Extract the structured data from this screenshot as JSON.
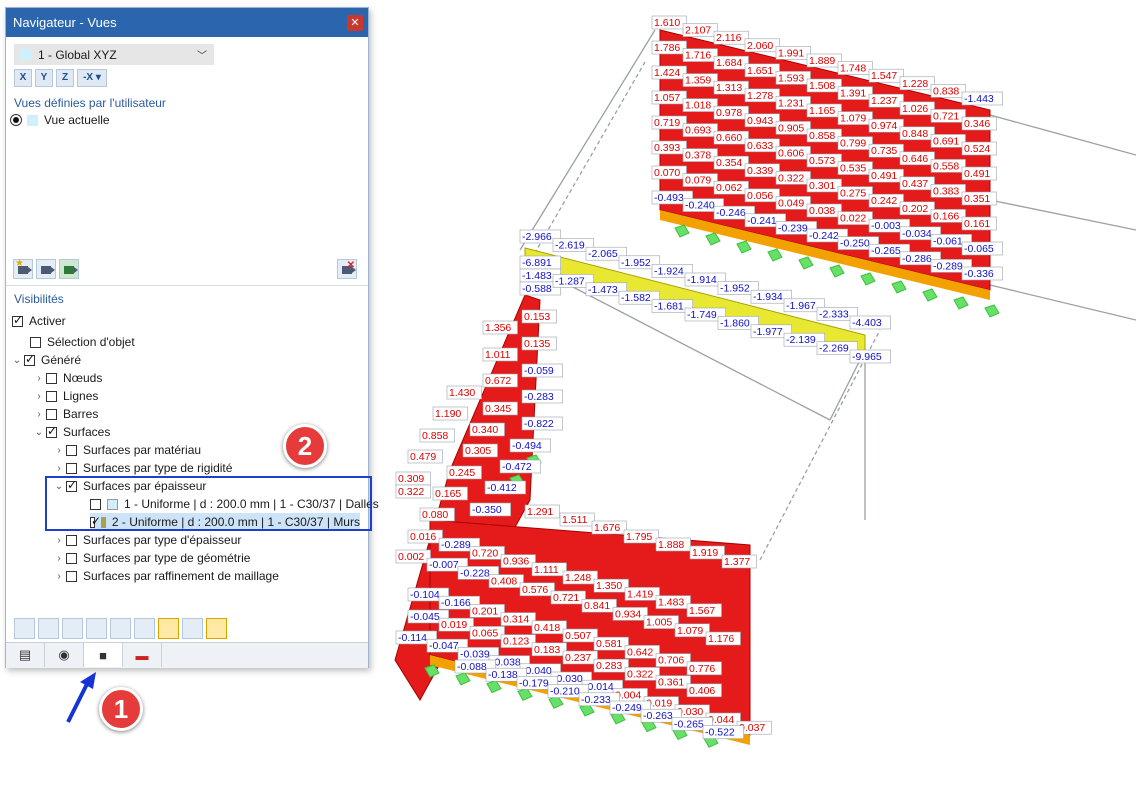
{
  "panel": {
    "title": "Navigateur - Vues",
    "close_icon": "close-icon",
    "view_select": "1 - Global XYZ",
    "axis_buttons": [
      "X",
      "Y",
      "Z",
      "-X"
    ],
    "user_views_heading": "Vues définies par l'utilisateur",
    "current_view": "Vue actuelle",
    "visibilities_heading": "Visibilités",
    "tree": [
      {
        "label": "Activer",
        "checked": true
      },
      {
        "label": "Sélection d'objet",
        "checked": false
      },
      {
        "label": "Généré",
        "checked": true
      },
      {
        "label": "Nœuds",
        "checked": false
      },
      {
        "label": "Lignes",
        "checked": false
      },
      {
        "label": "Barres",
        "checked": false
      },
      {
        "label": "Surfaces",
        "checked": true
      },
      {
        "label": "Surfaces par matériau",
        "checked": false
      },
      {
        "label": "Surfaces par type de rigidité",
        "checked": false
      },
      {
        "label": "Surfaces par épaisseur",
        "checked": true
      },
      {
        "label": "1 - Uniforme | d : 200.0 mm | 1 - C30/37 | Dalles",
        "checked": false,
        "color": "#cfeffb"
      },
      {
        "label": "2 - Uniforme | d : 200.0 mm | 1 - C30/37 | Murs",
        "checked": true,
        "color": "#a9a24a"
      },
      {
        "label": "Surfaces par type d'épaisseur",
        "checked": false
      },
      {
        "label": "Surfaces par type de géométrie",
        "checked": false
      },
      {
        "label": "Surfaces par raffinement de maillage",
        "checked": false
      }
    ],
    "tabs": [
      "navigator-data-icon",
      "eye-icon",
      "camera-icon",
      "result-icon"
    ]
  },
  "callouts": {
    "one": "1",
    "two": "2"
  },
  "colors": {
    "title_bar": "#2a65ad",
    "highlight_box": "#1f3fc8",
    "callout": "#e53b3b",
    "positive": "#e00000",
    "negative": "#1010c8",
    "support": "#66e066"
  },
  "model_values": {
    "top_slab": [
      "1.610",
      "2.107",
      "2.116",
      "2.060",
      "1.991",
      "1.889",
      "1.748",
      "1.547",
      "1.228",
      "0.838",
      "-1.443",
      "1.786",
      "1.716",
      "1.684",
      "1.651",
      "1.593",
      "1.508",
      "1.391",
      "1.237",
      "1.026",
      "0.721",
      "0.346",
      "1.424",
      "1.359",
      "1.313",
      "1.278",
      "1.231",
      "1.165",
      "1.079",
      "0.974",
      "0.848",
      "0.691",
      "0.524",
      "1.057",
      "1.018",
      "0.978",
      "0.943",
      "0.905",
      "0.858",
      "0.799",
      "0.735",
      "0.646",
      "0.558",
      "0.491",
      "0.719",
      "0.693",
      "0.660",
      "0.633",
      "0.606",
      "0.573",
      "0.535",
      "0.491",
      "0.437",
      "0.383",
      "0.351",
      "0.393",
      "0.378",
      "0.354",
      "0.339",
      "0.322",
      "0.301",
      "0.275",
      "0.242",
      "0.202",
      "0.166",
      "0.161",
      "0.070",
      "0.079",
      "0.062",
      "0.056",
      "0.049",
      "0.038",
      "0.022",
      "-0.003",
      "-0.034",
      "-0.061",
      "-0.065",
      "-0.493",
      "-0.240",
      "-0.246",
      "-0.241",
      "-0.239",
      "-0.242",
      "-0.250",
      "-0.265",
      "-0.286",
      "-0.289",
      "-0.336"
    ],
    "beam": [
      "-2.966",
      "-2.619",
      "-2.065",
      "-1.952",
      "-1.924",
      "-1.914",
      "-1.952",
      "-1.934",
      "-1.967",
      "-2.333",
      "-4.403",
      "-6.891",
      "-1.483",
      "-0.588",
      "-1.287",
      "-1.473",
      "-1.582",
      "-1.681",
      "-1.749",
      "-1.860",
      "-1.977",
      "-2.139",
      "-2.269",
      "-9.965"
    ],
    "wall_left": [
      "1.356",
      "1.011",
      "0.153",
      "0.135",
      "-0.059",
      "1.430",
      "0.672",
      "1.190",
      "0.345",
      "-0.283",
      "0.858",
      "0.340",
      "-0.822",
      "0.479",
      "0.305",
      "-0.494",
      "0.309",
      "0.245",
      "-0.472",
      "0.322",
      "0.165",
      "-0.412",
      "0.080",
      "-0.350"
    ],
    "bottom_slab": [
      "1.291",
      "1.511",
      "1.676",
      "1.795",
      "1.888",
      "1.919",
      "1.377",
      "0.016",
      "-0.289",
      "0.720",
      "0.936",
      "1.111",
      "1.248",
      "1.350",
      "1.419",
      "1.483",
      "1.567",
      "0.002",
      "-0.007",
      "-0.228",
      "0.408",
      "0.576",
      "0.721",
      "0.841",
      "0.934",
      "1.005",
      "1.079",
      "1.176",
      "-0.104",
      "-0.166",
      "0.201",
      "0.314",
      "0.418",
      "0.507",
      "0.581",
      "0.642",
      "0.706",
      "0.776",
      "-0.045",
      "0.019",
      "0.065",
      "0.123",
      "0.183",
      "0.237",
      "0.283",
      "0.322",
      "0.361",
      "0.406",
      "-0.114",
      "-0.047",
      "-0.039",
      "-0.038",
      "-0.040",
      "-0.030",
      "-0.014",
      "0.004",
      "0.019",
      "0.030",
      "0.044",
      "0.037",
      "-0.088",
      "-0.138",
      "-0.179",
      "-0.210",
      "-0.233",
      "-0.249",
      "-0.263",
      "-0.265",
      "-0.522"
    ]
  }
}
